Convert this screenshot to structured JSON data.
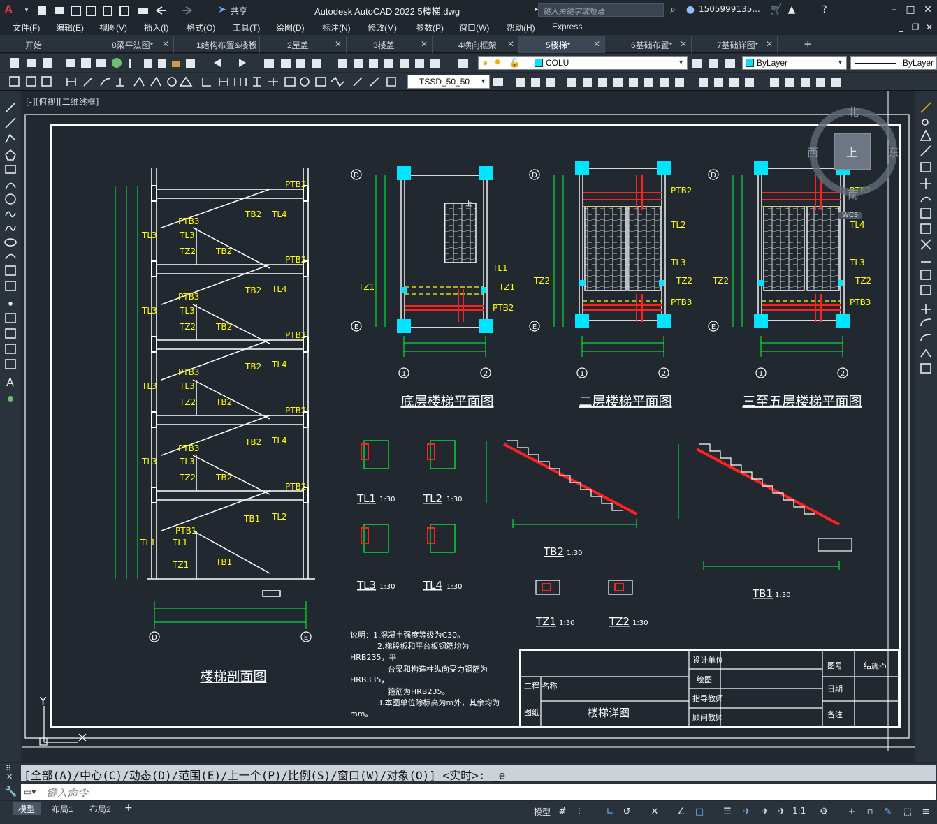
{
  "app": {
    "logo": "A",
    "title": "Autodesk AutoCAD 2022    5楼梯.dwg",
    "share_label": "共享",
    "search_placeholder": "键入关键字或短语",
    "user": "1505999135..."
  },
  "menus": [
    "文件(F)",
    "编辑(E)",
    "视图(V)",
    "插入(I)",
    "格式(O)",
    "工具(T)",
    "绘图(D)",
    "标注(N)",
    "修改(M)",
    "参数(P)",
    "窗口(W)",
    "帮助(H)",
    "Express"
  ],
  "tabs": [
    {
      "label": "开始",
      "close": false,
      "active": false
    },
    {
      "label": "8梁平法图*",
      "close": true,
      "active": false
    },
    {
      "label": "1结构布置&楼板",
      "close": true,
      "active": false
    },
    {
      "label": "2屋盖",
      "close": true,
      "active": false
    },
    {
      "label": "3楼盖",
      "close": true,
      "active": false
    },
    {
      "label": "4横向框架",
      "close": true,
      "active": false
    },
    {
      "label": "5楼梯*",
      "close": true,
      "active": true
    },
    {
      "label": "6基础布置*",
      "close": true,
      "active": false
    },
    {
      "label": "7基础详图*",
      "close": true,
      "active": false
    }
  ],
  "tab_add": "+",
  "layer": {
    "name": "COLU",
    "color": "#00e5ff"
  },
  "color_dropdown": {
    "value": "ByLayer",
    "color": "#00e5ff"
  },
  "linetype_dropdown": {
    "value": "ByLayer"
  },
  "dimstyle_dropdown": {
    "value": "TSSD_50_50"
  },
  "viewport_label": "[-][俯视][二维线框]",
  "viewcube": {
    "n": "北",
    "s": "南",
    "e": "东",
    "w": "西",
    "top": "上",
    "wcs": "WCS"
  },
  "drawing": {
    "titles": {
      "section": "楼梯剖面图",
      "plan1": "底层楼梯平面图",
      "plan2": "二层楼梯平面图",
      "plan3": "三至五层楼梯平面图"
    },
    "section_labels": {
      "ptb2": "PTB2",
      "ptb3": "PTB3",
      "ptb1": "PTB1",
      "tb2": "TB2",
      "tb1": "TB1",
      "tl4": "TL4",
      "tl3": "TL3",
      "tl2": "TL2",
      "tl1": "TL1",
      "tz2": "TZ2",
      "tz1": "TZ1",
      "axis_d": "D",
      "axis_e": "E"
    },
    "plan_labels": {
      "axis_1": "1",
      "axis_2": "2",
      "axis_d": "D",
      "axis_e": "E",
      "tz1": "TZ1",
      "tz2": "TZ2",
      "tl1": "TL1",
      "tl2": "TL2",
      "tl3": "TL3",
      "tl4": "TL4",
      "ptb2": "PTB2",
      "ptb3": "PTB3",
      "up": "上"
    },
    "details": [
      {
        "name": "TL1",
        "scale": "1:30"
      },
      {
        "name": "TL2",
        "scale": "1:30"
      },
      {
        "name": "TL3",
        "scale": "1:30"
      },
      {
        "name": "TL4",
        "scale": "1:30"
      },
      {
        "name": "TZ1",
        "scale": "1:30"
      },
      {
        "name": "TZ2",
        "scale": "1:30"
      },
      {
        "name": "TB2",
        "scale": "1:30"
      },
      {
        "name": "TB1",
        "scale": "1:30"
      }
    ],
    "notes": [
      "说明：1.混凝土强度等级为C30。",
      "2.梯段板和平台板钢筋均为",
      "HRB235，平",
      "台梁和构造柱纵向受力钢筋为",
      "HRB335，",
      "箍筋为HRB235。",
      "3.本图单位除标高为m外，其余均为",
      "mm。"
    ],
    "title_block": {
      "design_unit": "设计单位",
      "drawn": "绘图",
      "teacher1": "指导教师",
      "teacher2": "顾问教师",
      "project_name": "工程\n名称",
      "drawing_name_label": "图纸",
      "drawing_name": "楼梯详图",
      "sheet_no_label": "图号",
      "sheet_no": "结施-5",
      "date": "日期",
      "remarks": "备注"
    },
    "ucs": {
      "y": "Y"
    }
  },
  "command": {
    "history": "[全部(A)/中心(C)/动态(D)/范围(E)/上一个(P)/比例(S)/窗口(W)/对象(O)] <实时>: _e",
    "placeholder": "键入命令"
  },
  "layout_tabs": [
    "模型",
    "布局1",
    "布局2"
  ],
  "layout_add": "+",
  "status": {
    "model": "模型",
    "scale": "1:1"
  }
}
